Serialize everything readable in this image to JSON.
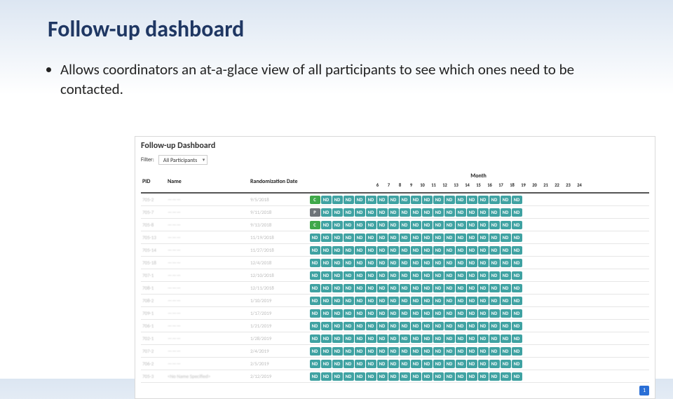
{
  "slide": {
    "title": "Follow-up dashboard",
    "bullet": "Allows coordinators an at-a-glace view of all participants to see which ones need to be contacted."
  },
  "dashboard": {
    "title": "Follow-up Dashboard",
    "filter_label": "Filter:",
    "filter_selected": "All Participants",
    "columns": {
      "pid": "PID",
      "name": "Name",
      "rand_date": "Randomization Date",
      "month": "Month"
    },
    "month_numbers": [
      "6",
      "7",
      "8",
      "9",
      "10",
      "11",
      "12",
      "13",
      "14",
      "15",
      "16",
      "17",
      "18",
      "19",
      "20",
      "21",
      "22",
      "23",
      "24"
    ],
    "rows": [
      {
        "pid": "705-2",
        "name": "———",
        "date": "9/5/2018",
        "first_cell": "C"
      },
      {
        "pid": "705-7",
        "name": "———",
        "date": "9/11/2018",
        "first_cell": "P"
      },
      {
        "pid": "705-8",
        "name": "———",
        "date": "9/13/2018",
        "first_cell": "C"
      },
      {
        "pid": "705-13",
        "name": "———",
        "date": "11/19/2018",
        "first_cell": "ND"
      },
      {
        "pid": "705-14",
        "name": "———",
        "date": "11/27/2018",
        "first_cell": "ND"
      },
      {
        "pid": "705-18",
        "name": "———",
        "date": "12/4/2018",
        "first_cell": "ND"
      },
      {
        "pid": "707-1",
        "name": "———",
        "date": "12/10/2018",
        "first_cell": "ND"
      },
      {
        "pid": "708-1",
        "name": "———",
        "date": "12/11/2018",
        "first_cell": "ND"
      },
      {
        "pid": "708-2",
        "name": "———",
        "date": "1/10/2019",
        "first_cell": "ND"
      },
      {
        "pid": "709-1",
        "name": "———",
        "date": "1/17/2019",
        "first_cell": "ND"
      },
      {
        "pid": "706-1",
        "name": "———",
        "date": "1/21/2019",
        "first_cell": "ND"
      },
      {
        "pid": "702-1",
        "name": "———",
        "date": "1/28/2019",
        "first_cell": "ND"
      },
      {
        "pid": "707-2",
        "name": "———",
        "date": "2/4/2019",
        "first_cell": "ND"
      },
      {
        "pid": "706-2",
        "name": "———",
        "date": "2/5/2019",
        "first_cell": "ND"
      },
      {
        "pid": "705-3",
        "name": "<No Name Specified>",
        "date": "2/12/2019",
        "first_cell": "ND"
      }
    ],
    "cell_values": {
      "nd": "ND",
      "c": "C",
      "p": "P"
    },
    "pager": {
      "current": "1"
    }
  }
}
